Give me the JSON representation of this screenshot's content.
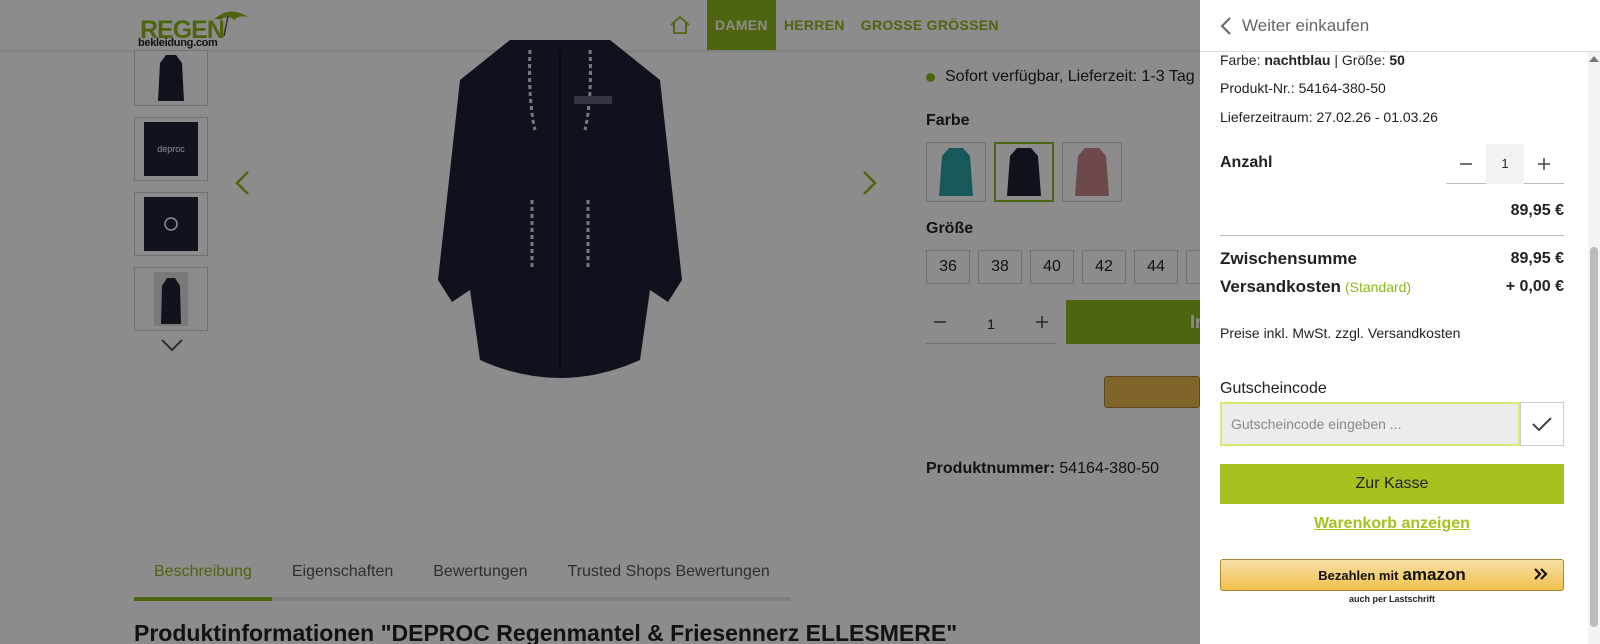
{
  "colors": {
    "brand_green": "#8fb81c",
    "checkout_green": "#a5c21f",
    "overlay": "rgba(0,0,0,0.45)",
    "amazon_gold": "#f0c14b"
  },
  "header": {
    "logo_main": "REGEN",
    "logo_sub": "bekleidung.com",
    "home_icon": "home-icon",
    "nav": [
      "DAMEN",
      "HERREN",
      "GROSSE GRÖSSEN"
    ],
    "active_nav": "DAMEN"
  },
  "product": {
    "thumb_label": "deproc",
    "availability": "Sofort verfügbar, Lieferzeit: 1-3 Tag",
    "color_label": "Farbe",
    "size_label": "Größe",
    "sizes": [
      "36",
      "38",
      "40",
      "42",
      "44"
    ],
    "quantity": "1",
    "buy_label": "In",
    "product_number_label": "Produktnummer:",
    "product_number": "54164-380-50"
  },
  "tabs": [
    "Beschreibung",
    "Eigenschaften",
    "Bewertungen",
    "Trusted Shops Bewertungen"
  ],
  "active_tab": "Beschreibung",
  "product_heading": "Produktinformationen \"DEPROC Regenmantel & Friesennerz ELLESMERE\"",
  "cart": {
    "back_label": "Weiter einkaufen",
    "color_label": "Farbe:",
    "color_value": "nachtblau",
    "separator": "|",
    "size_label": "Größe:",
    "size_value": "50",
    "product_no_label": "Produkt-Nr.:",
    "product_no": "54164-380-50",
    "delivery_label": "Lieferzeitraum:",
    "delivery_value": "27.02.26 - 01.03.26",
    "quantity_label": "Anzahl",
    "quantity": "1",
    "line_price": "89,95 €",
    "subtotal_label": "Zwischensumme",
    "subtotal": "89,95 €",
    "shipping_label": "Versandkosten",
    "shipping_note": "(Standard)",
    "shipping": "+ 0,00 €",
    "tax_note": "Preise inkl. MwSt. zzgl. Versandkosten",
    "voucher_label": "Gutscheincode",
    "voucher_placeholder": "Gutscheincode eingeben ...",
    "checkout_label": "Zur Kasse",
    "view_cart_label": "Warenkorb anzeigen",
    "amazon_pay_text": "Bezahlen mit",
    "amazon_brand": "amazon",
    "amazon_sub": "auch per Lastschrift"
  }
}
